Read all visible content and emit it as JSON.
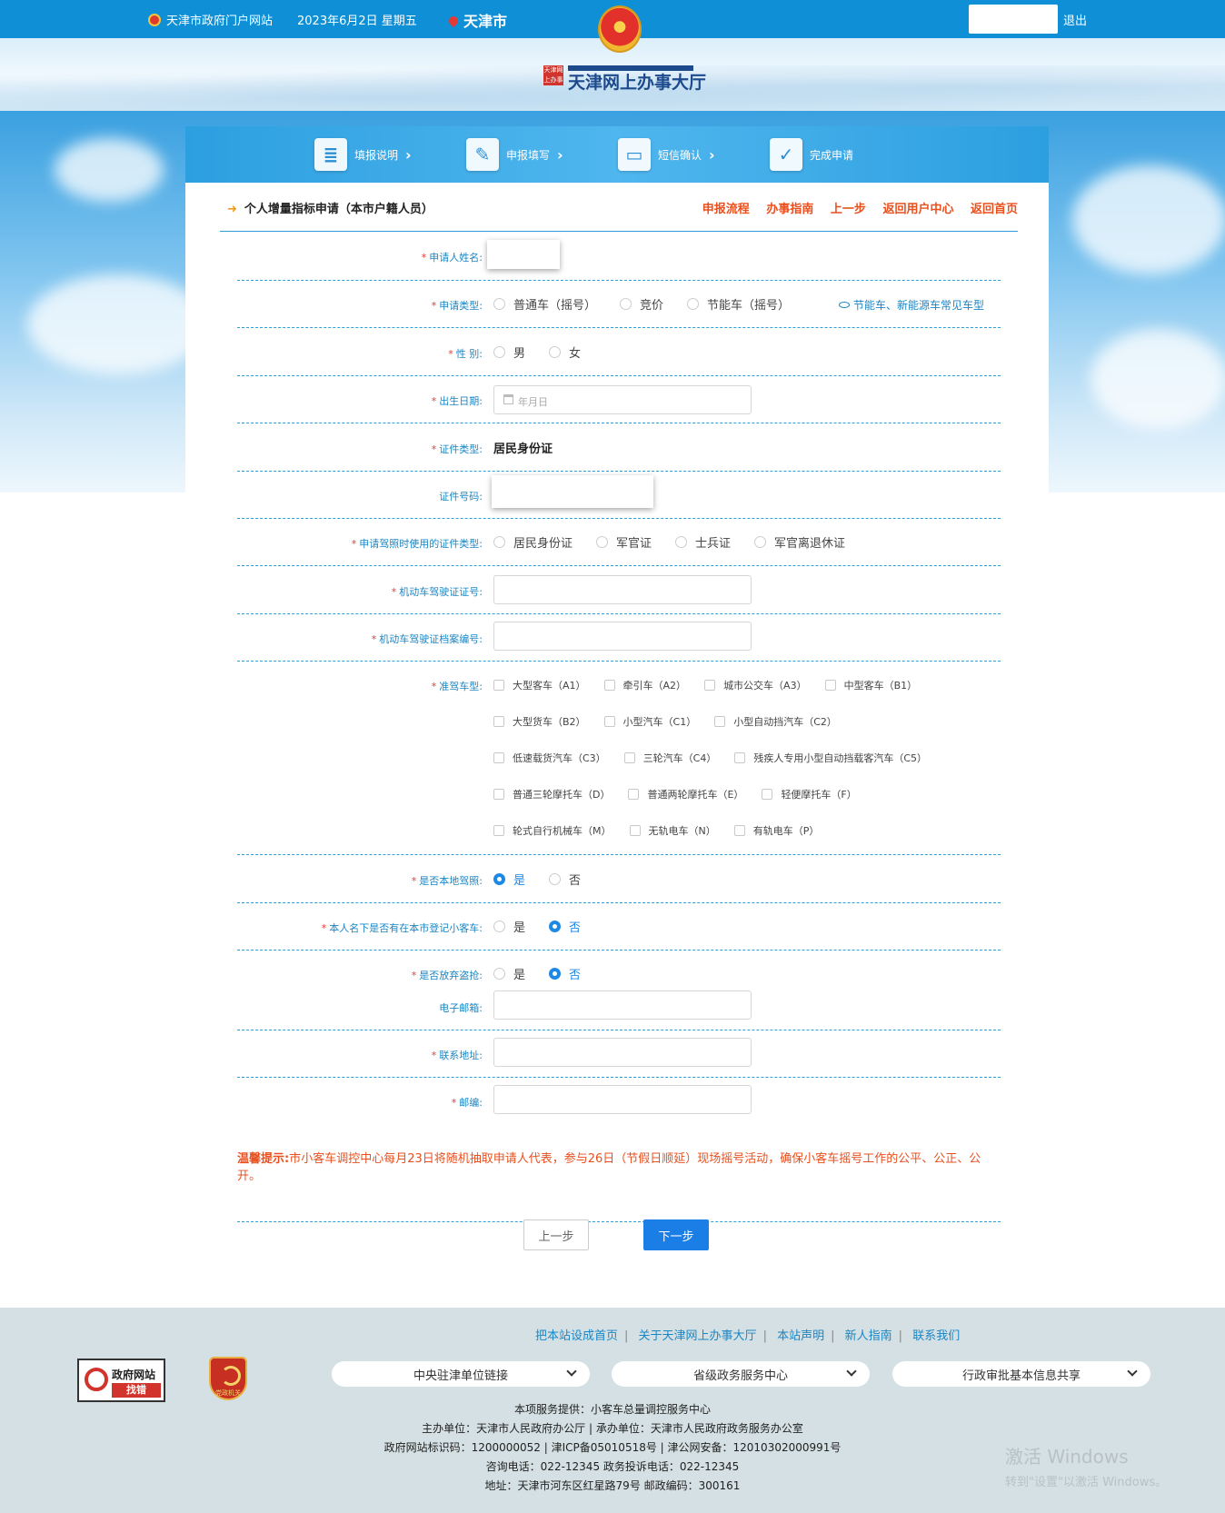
{
  "topbar": {
    "site_name": "天津市政府门户网站",
    "date": "2023年6月2日 星期五",
    "city": "天津市",
    "logout": "退出"
  },
  "header": {
    "logo_mark": "天津网上办事",
    "logo_title": "天津网上办事大厅"
  },
  "steps": [
    {
      "label": "填报说明",
      "icon": "document-icon"
    },
    {
      "label": "申报填写",
      "icon": "edit-icon"
    },
    {
      "label": "短信确认",
      "icon": "phone-icon"
    },
    {
      "label": "完成申请",
      "icon": "check-icon"
    }
  ],
  "page": {
    "title": "个人增量指标申请（本市户籍人员）",
    "links": [
      "申报流程",
      "办事指南",
      "上一步",
      "返回用户中心",
      "返回首页"
    ]
  },
  "form": {
    "name_label": "申请人姓名:",
    "apply_type_label": "申请类型:",
    "apply_type_options": [
      "普通车（摇号）",
      "竞价",
      "节能车（摇号）"
    ],
    "apply_type_hint": "节能车、新能源车常见车型",
    "gender_label": "性 别:",
    "gender_options": [
      "男",
      "女"
    ],
    "birth_label": "出生日期:",
    "birth_placeholder": "年月日",
    "id_type_label": "证件类型:",
    "id_type_value": "居民身份证",
    "id_no_label": "证件号码:",
    "license_id_type_label": "申请驾照时使用的证件类型:",
    "license_id_type_options": [
      "居民身份证",
      "军官证",
      "士兵证",
      "军官离退休证"
    ],
    "license_no_label": "机动车驾驶证证号:",
    "license_file_label": "机动车驾驶证档案编号:",
    "vehicle_class_label": "准驾车型:",
    "vehicle_classes": [
      [
        "大型客车（A1）",
        "牵引车（A2）",
        "城市公交车（A3）",
        "中型客车（B1）"
      ],
      [
        "大型货车（B2）",
        "小型汽车（C1）",
        "小型自动挡汽车（C2）"
      ],
      [
        "低速载货汽车（C3）",
        "三轮汽车（C4）",
        "残疾人专用小型自动挡载客汽车（C5）"
      ],
      [
        "普通三轮摩托车（D）",
        "普通两轮摩托车（E）",
        "轻便摩托车（F）"
      ],
      [
        "轮式自行机械车（M）",
        "无轨电车（N）",
        "有轨电车（P）"
      ]
    ],
    "local_license_label": "是否本地驾照:",
    "local_license_selected": "是",
    "has_car_label": "本人名下是否有在本市登记小客车:",
    "has_car_selected": "否",
    "give_up_label": "是否放弃盗抢:",
    "give_up_selected": "否",
    "yes": "是",
    "no": "否",
    "email_label": "电子邮箱:",
    "address_label": "联系地址:",
    "zip_label": "邮编:",
    "tip_title": "温馨提示:",
    "tip_text": "市小客车调控中心每月23日将随机抽取申请人代表，参与26日（节假日顺延）现场摇号活动，确保小客车摇号工作的公平、公正、公开。",
    "prev_button": "上一步",
    "next_button": "下一步"
  },
  "footer": {
    "links": [
      "把本站设成首页",
      "关于天津网上办事大厅",
      "本站声明",
      "新人指南",
      "联系我们"
    ],
    "gov_badge_line1": "政府网站",
    "gov_badge_line2": "找错",
    "party_badge": "党政机关",
    "selects": [
      "中央驻津单位链接",
      "省级政务服务中心",
      "行政审批基本信息共享"
    ],
    "service": "本项服务提供：小客车总量调控服务中心",
    "sponsor": "主办单位：天津市人民政府办公厅 | 承办单位：天津市人民政府政务服务办公室",
    "icp": "政府网站标识码：1200000052 | 津ICP备05010518号 | 津公网安备：12010302000991号",
    "phone": "咨询电话：022-12345 政务投诉电话：022-12345",
    "address": "地址：天津市河东区红星路79号 邮政编码：300161",
    "watermark_1": "激活 Windows",
    "watermark_2": "转到\"设置\"以激活 Windows。"
  }
}
